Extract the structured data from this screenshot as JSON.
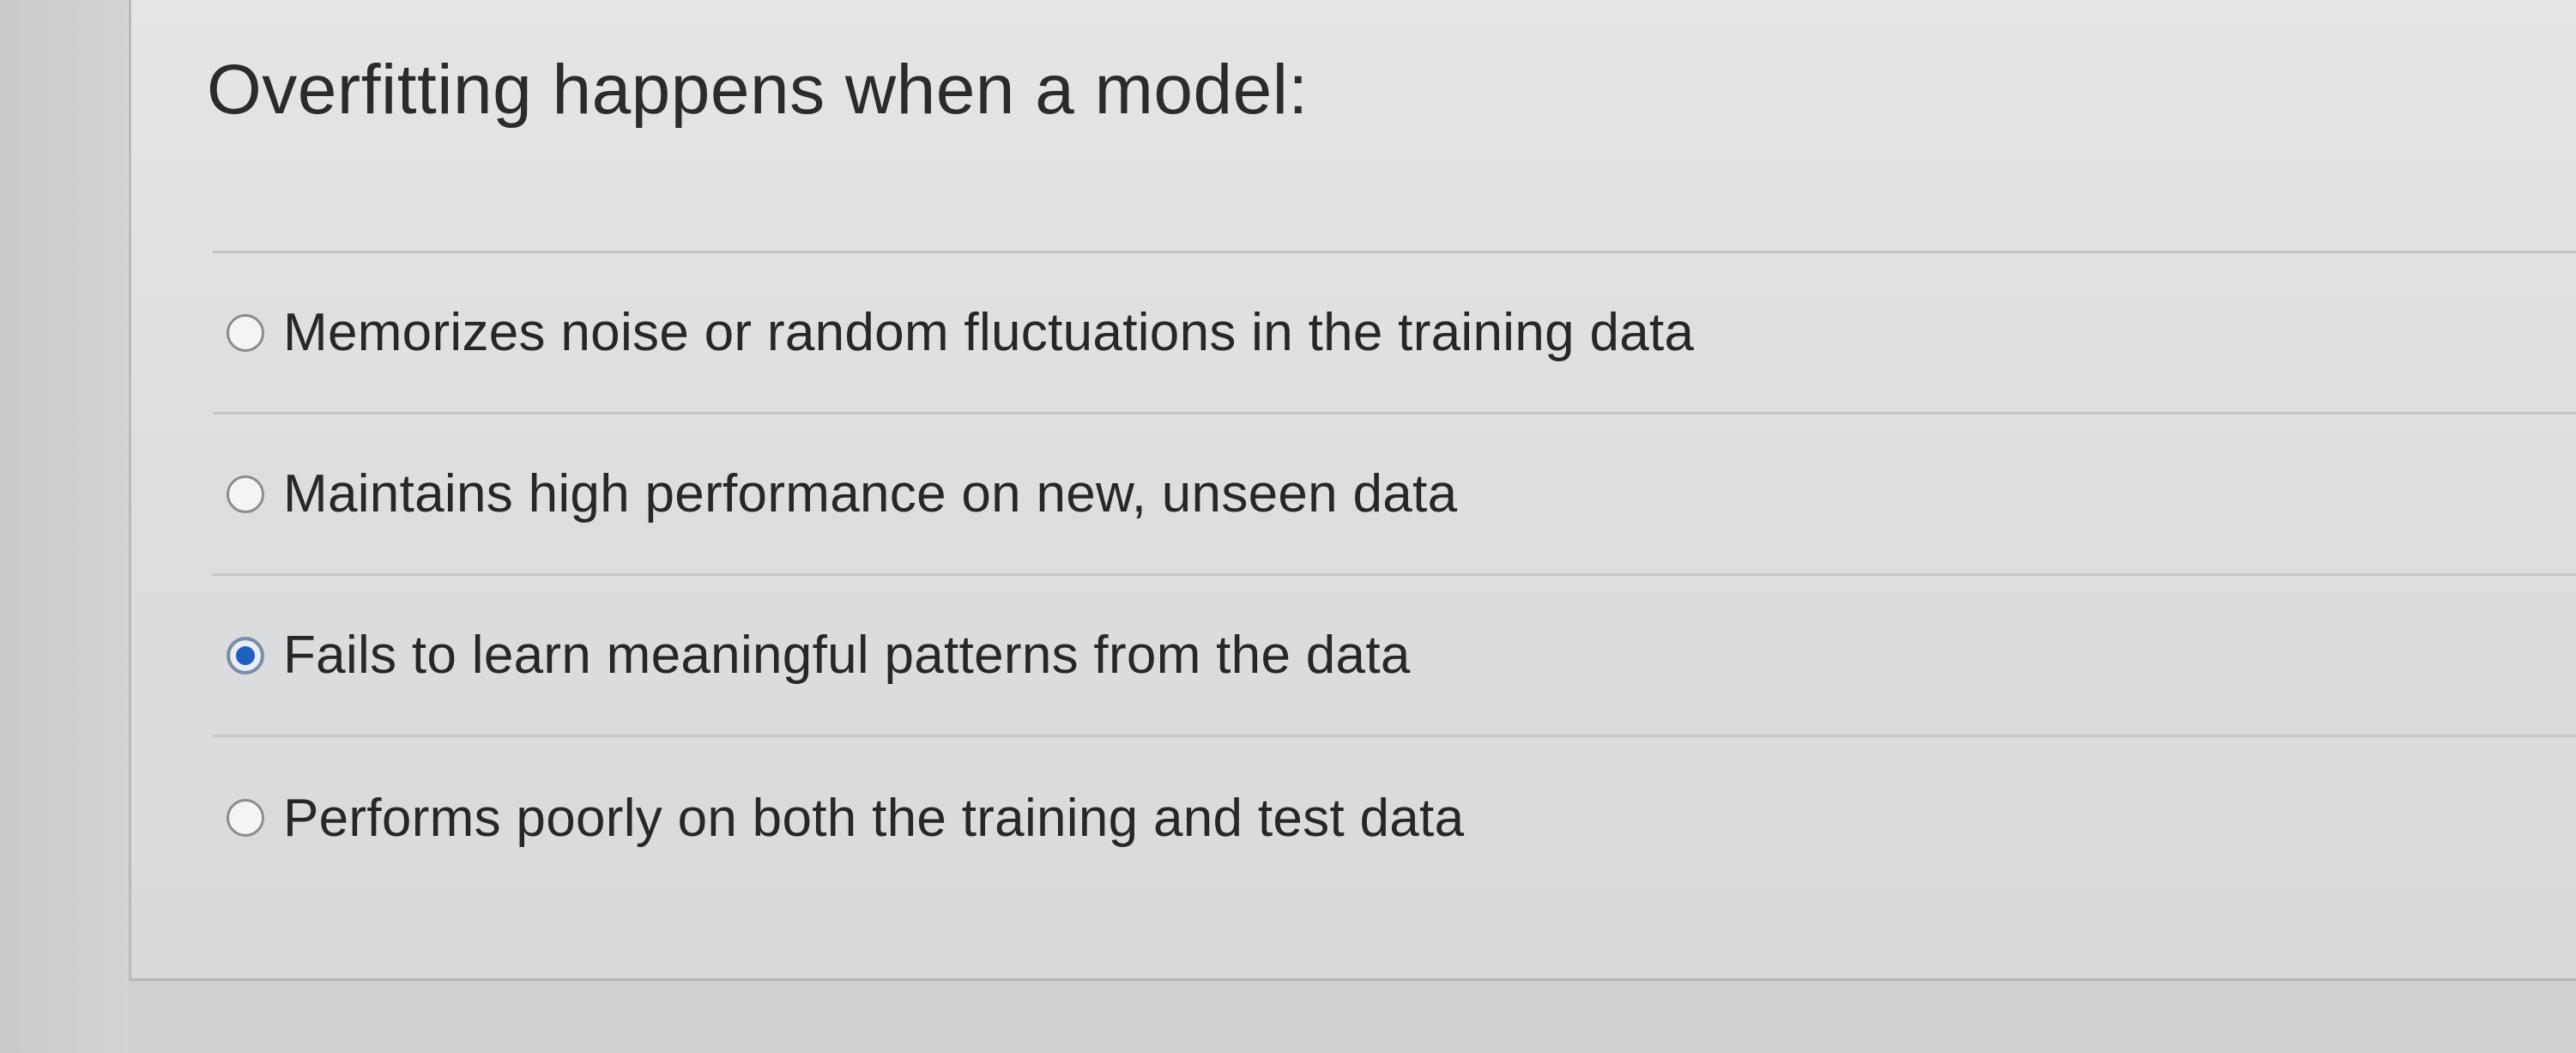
{
  "question": {
    "text": "Overfitting happens when a model:"
  },
  "answers": [
    {
      "label": "Memorizes noise or random fluctuations in the training data",
      "selected": false
    },
    {
      "label": "Maintains high performance on new, unseen data",
      "selected": false
    },
    {
      "label": "Fails to learn meaningful patterns from the data",
      "selected": true
    },
    {
      "label": "Performs poorly on both the training and test data",
      "selected": false
    }
  ],
  "colors": {
    "selected_radio": "#1f5fbf",
    "text": "#26272a",
    "card_background": "#e0e1e2"
  }
}
